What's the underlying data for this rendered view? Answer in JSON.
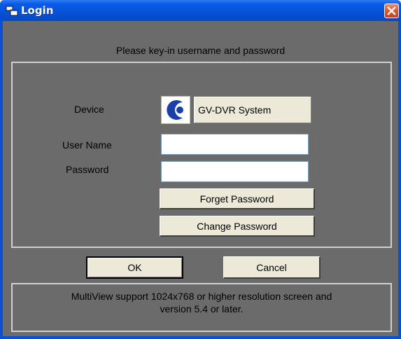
{
  "window": {
    "title": "Login",
    "close_symbol": "×",
    "title_icon": "windows-app-icon",
    "colors": {
      "titlebar": "#0651d8",
      "client": "#6b6b6b",
      "button": "#ece9d8",
      "close": "#d75a35"
    }
  },
  "prompt": "Please key-in username and password",
  "form": {
    "device_label": "Device",
    "device_icon": "geovision-logo-icon",
    "device_value": "GV-DVR System",
    "username_label": "User Name",
    "username_value": "",
    "password_label": "Password",
    "password_value": "",
    "forget_password_label": "Forget Password",
    "change_password_label": "Change Password"
  },
  "actions": {
    "ok_label": "OK",
    "cancel_label": "Cancel"
  },
  "info": {
    "line1": "MultiView support 1024x768 or higher resolution screen and",
    "line2": "version 5.4 or later."
  }
}
